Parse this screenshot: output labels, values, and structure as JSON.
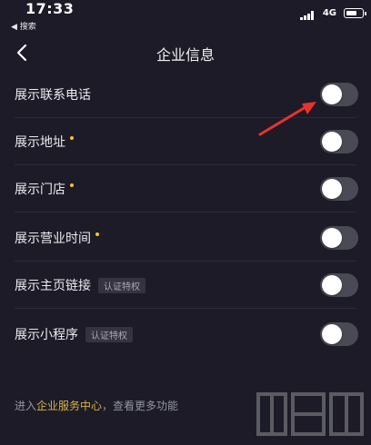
{
  "status_bar": {
    "time": "17:33",
    "back_app": "◀ 搜索",
    "network": "4G",
    "battery_level": 0.7
  },
  "nav": {
    "title": "企业信息"
  },
  "settings": [
    {
      "label": "展示联系电话",
      "required": false,
      "tag": "",
      "enabled": false
    },
    {
      "label": "展示地址",
      "required": true,
      "tag": "",
      "enabled": false
    },
    {
      "label": "展示门店",
      "required": true,
      "tag": "",
      "enabled": false
    },
    {
      "label": "展示营业时间",
      "required": true,
      "tag": "",
      "enabled": false
    },
    {
      "label": "展示主页链接",
      "required": false,
      "tag": "认证特权",
      "enabled": false
    },
    {
      "label": "展示小程序",
      "required": false,
      "tag": "认证特权",
      "enabled": false
    }
  ],
  "footer": {
    "prefix": "进入",
    "link": "企业服务中心",
    "suffix": "，查看更多功能"
  },
  "watermark": {
    "text": "下载吧"
  },
  "colors": {
    "background": "#1c1b27",
    "accent": "#d6b34a",
    "required_dot": "#f5c528",
    "annotation_arrow": "#e8332b"
  }
}
